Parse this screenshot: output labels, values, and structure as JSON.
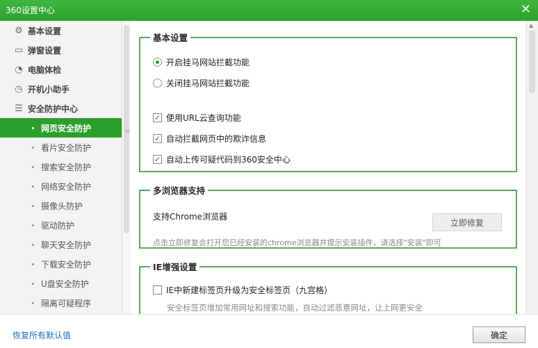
{
  "window": {
    "title": "360设置中心",
    "close_glyph": "✕"
  },
  "sidebar": {
    "groups": [
      {
        "label": "基本设置",
        "icon": "gear-icon"
      },
      {
        "label": "弹窗设置",
        "icon": "window-icon"
      },
      {
        "label": "电脑体检",
        "icon": "checkup-icon"
      },
      {
        "label": "开机小助手",
        "icon": "clock-icon"
      },
      {
        "label": "安全防护中心",
        "icon": "list-icon"
      }
    ],
    "sub_items": [
      {
        "label": "网页安全防护",
        "active": true
      },
      {
        "label": "看片安全防护"
      },
      {
        "label": "搜索安全防护"
      },
      {
        "label": "网络安全防护"
      },
      {
        "label": "摄像头防护"
      },
      {
        "label": "驱动防护"
      },
      {
        "label": "聊天安全防护"
      },
      {
        "label": "下载安全防护"
      },
      {
        "label": "U盘安全防护"
      },
      {
        "label": "隔离可疑程序"
      }
    ]
  },
  "basic": {
    "legend": "基本设置",
    "radio_on": "开启挂马网站拦截功能",
    "radio_off": "关闭挂马网站拦截功能",
    "check1": "使用URL云查询功能",
    "check2": "自动拦截网页中的欺诈信息",
    "check3": "自动上传可疑代码到360安全中心"
  },
  "browser": {
    "legend": "多浏览器支持",
    "support_text": "支持Chrome浏览器",
    "repair_button": "立即修复",
    "note": "点击立即修复会打开您已经安装的chrome浏览器并提示安装插件，请选择\"安装\"即可"
  },
  "ie": {
    "legend": "IE增强设置",
    "option": "IE中新建标签页升级为安全标签页（九宫格）",
    "desc": "安全标签页增加常用网址和搜索功能，自动过滤恶意网址，让上网更安全"
  },
  "footer": {
    "reset_link": "恢复所有默认值",
    "ok_button": "确定"
  },
  "colors": {
    "title_bar": "#2ca12c",
    "active_item": "#2b9e2b",
    "group_border": "#5aa85a",
    "link": "#1d6fb8"
  }
}
